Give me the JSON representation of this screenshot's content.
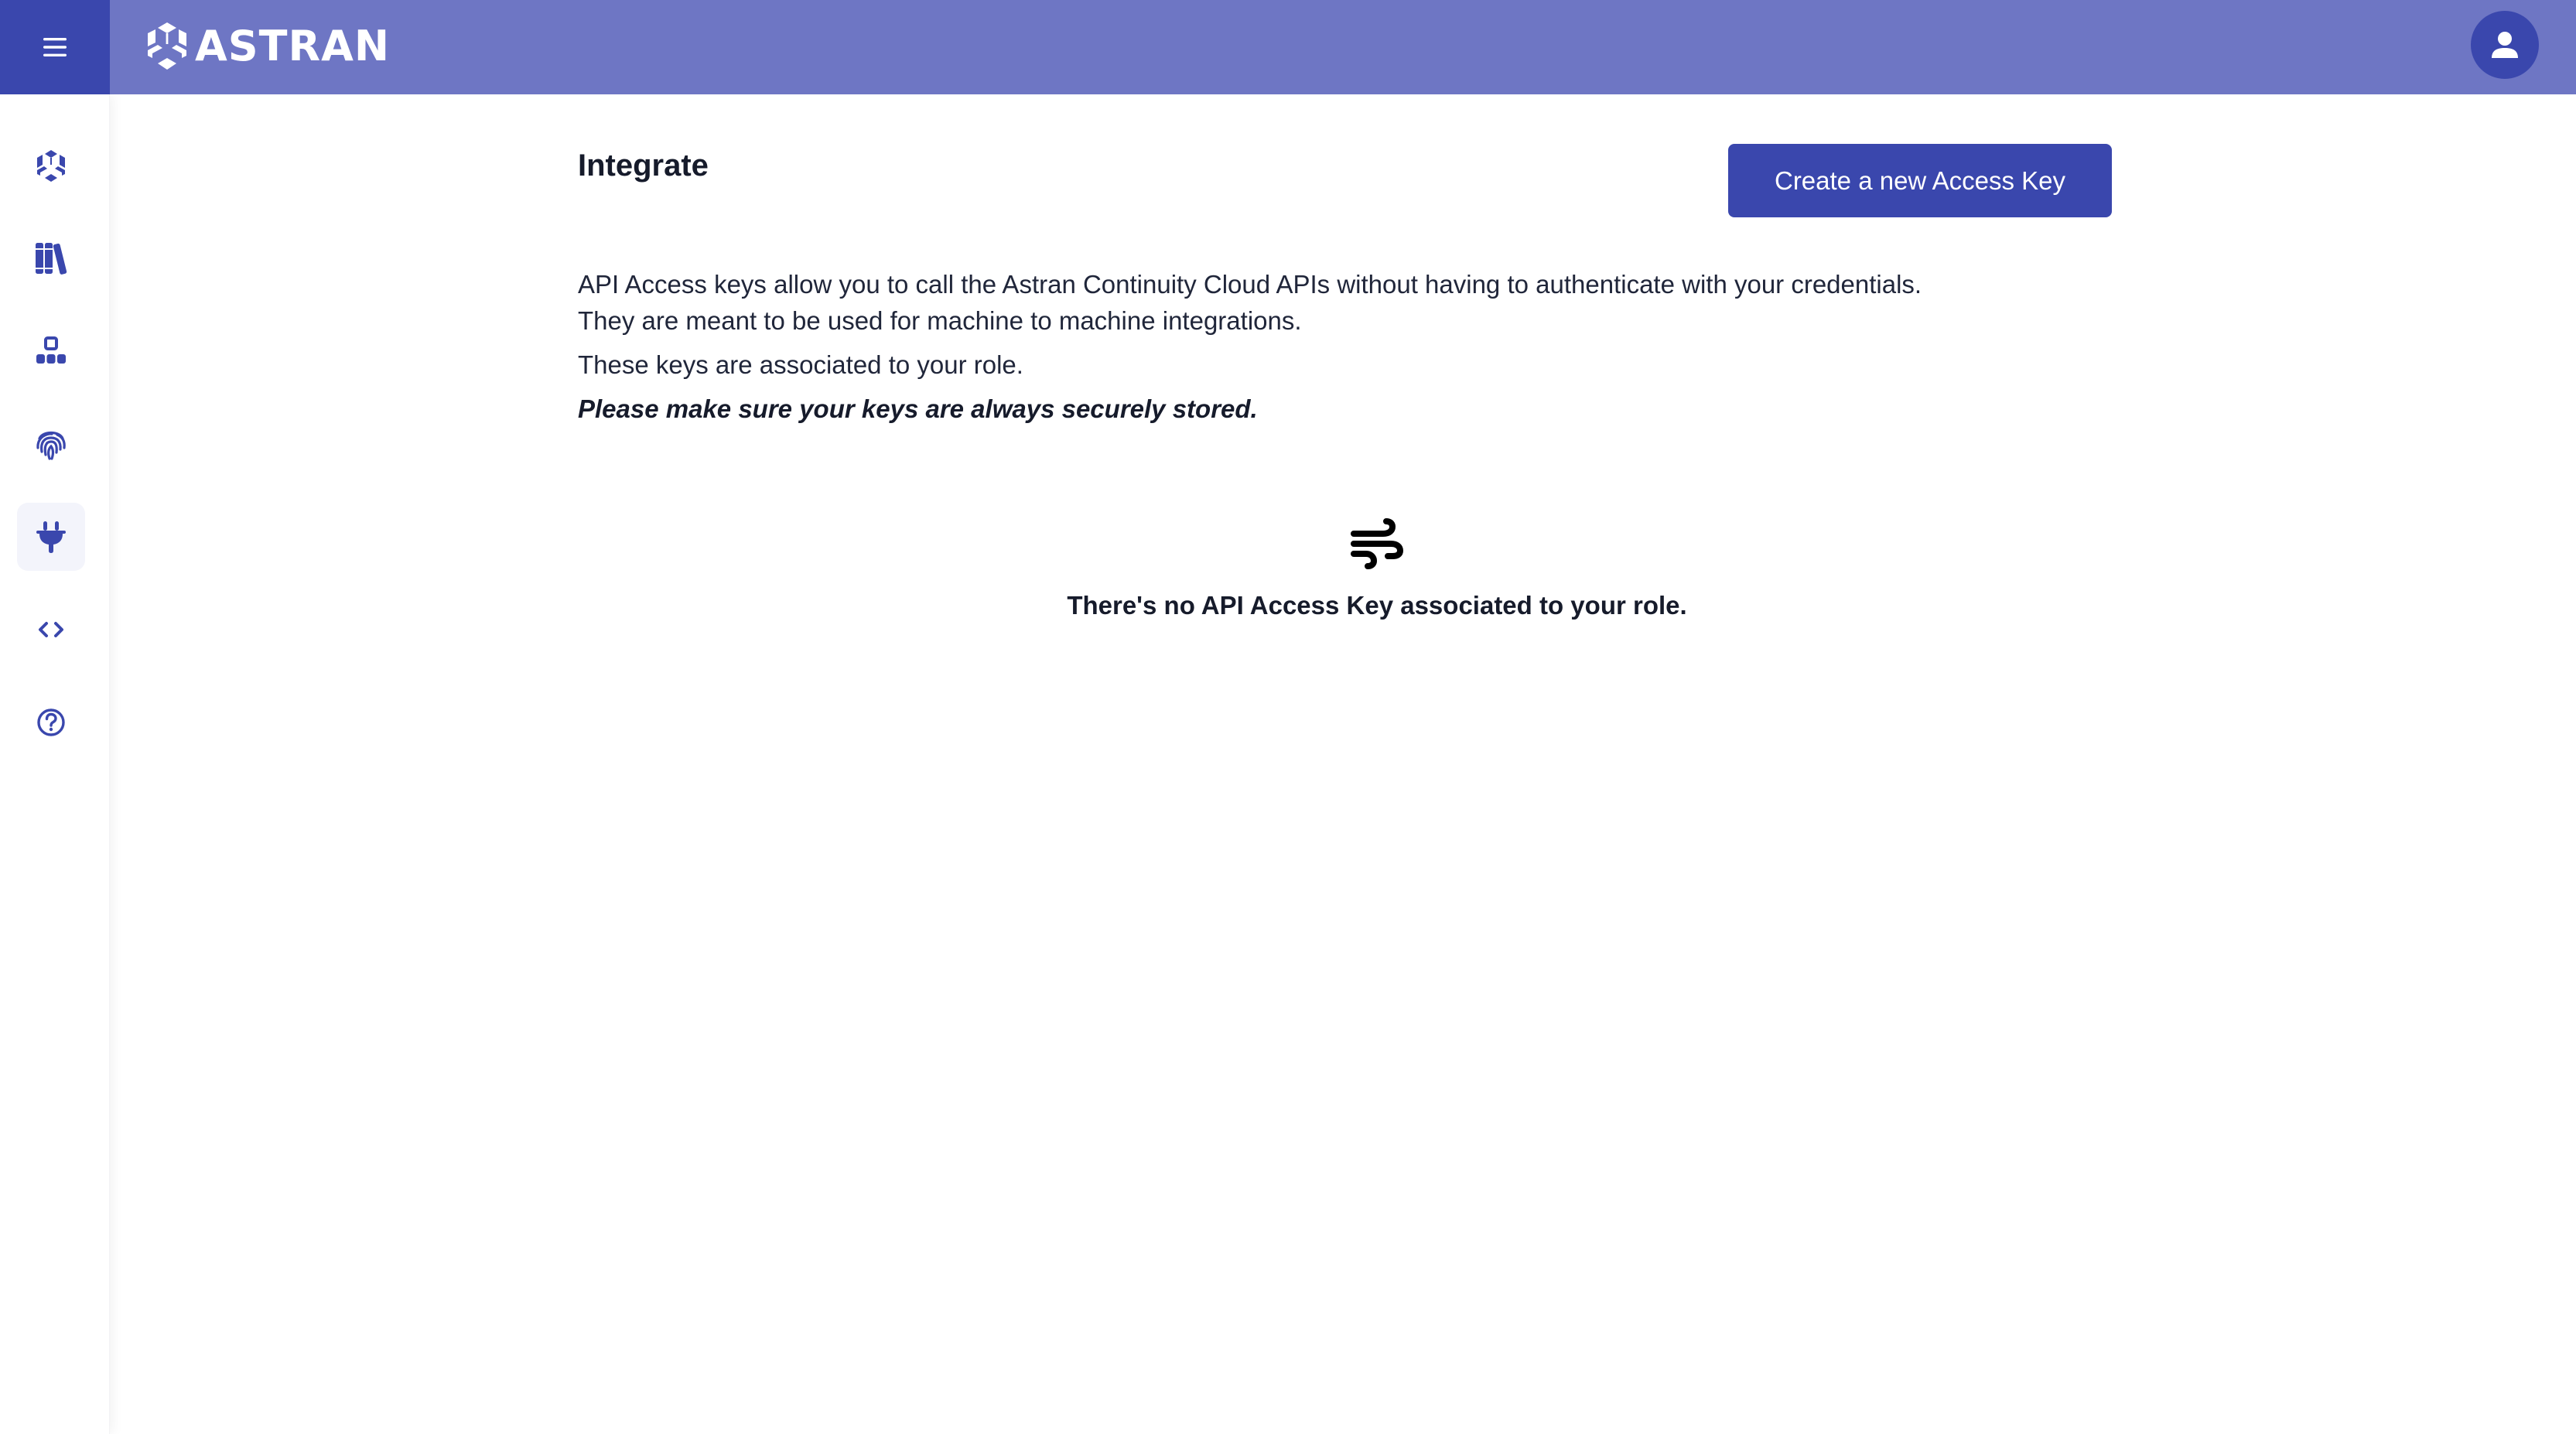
{
  "header": {
    "menu_icon": "hamburger-menu-icon",
    "brand": "ASTRAN",
    "logo_icon": "astran-hexagon-logo-icon",
    "avatar_icon": "user-icon",
    "colors": {
      "header_bg": "#6e76c4",
      "accent": "#3a47ad"
    }
  },
  "sidebar": {
    "active_index": 4,
    "items": [
      {
        "id": "home",
        "icon": "astran-hexagon-icon"
      },
      {
        "id": "library",
        "icon": "books-icon"
      },
      {
        "id": "organization",
        "icon": "hierarchy-icon"
      },
      {
        "id": "security",
        "icon": "fingerprint-icon"
      },
      {
        "id": "integrate",
        "icon": "plug-icon"
      },
      {
        "id": "developer",
        "icon": "code-brackets-icon"
      },
      {
        "id": "help",
        "icon": "help-circle-icon"
      }
    ]
  },
  "main": {
    "title": "Integrate",
    "create_button_label": "Create a new Access Key",
    "description": {
      "line1": "API Access keys allow you to call the Astran Continuity Cloud APIs without having to authenticate with your credentials.",
      "line2": "They are meant to be used for machine to machine integrations.",
      "line3": "These keys are associated to your role.",
      "warning": "Please make sure your keys are always securely stored."
    },
    "empty_state": {
      "icon": "wind-icon",
      "message": "There's no API Access Key associated to your role."
    }
  }
}
